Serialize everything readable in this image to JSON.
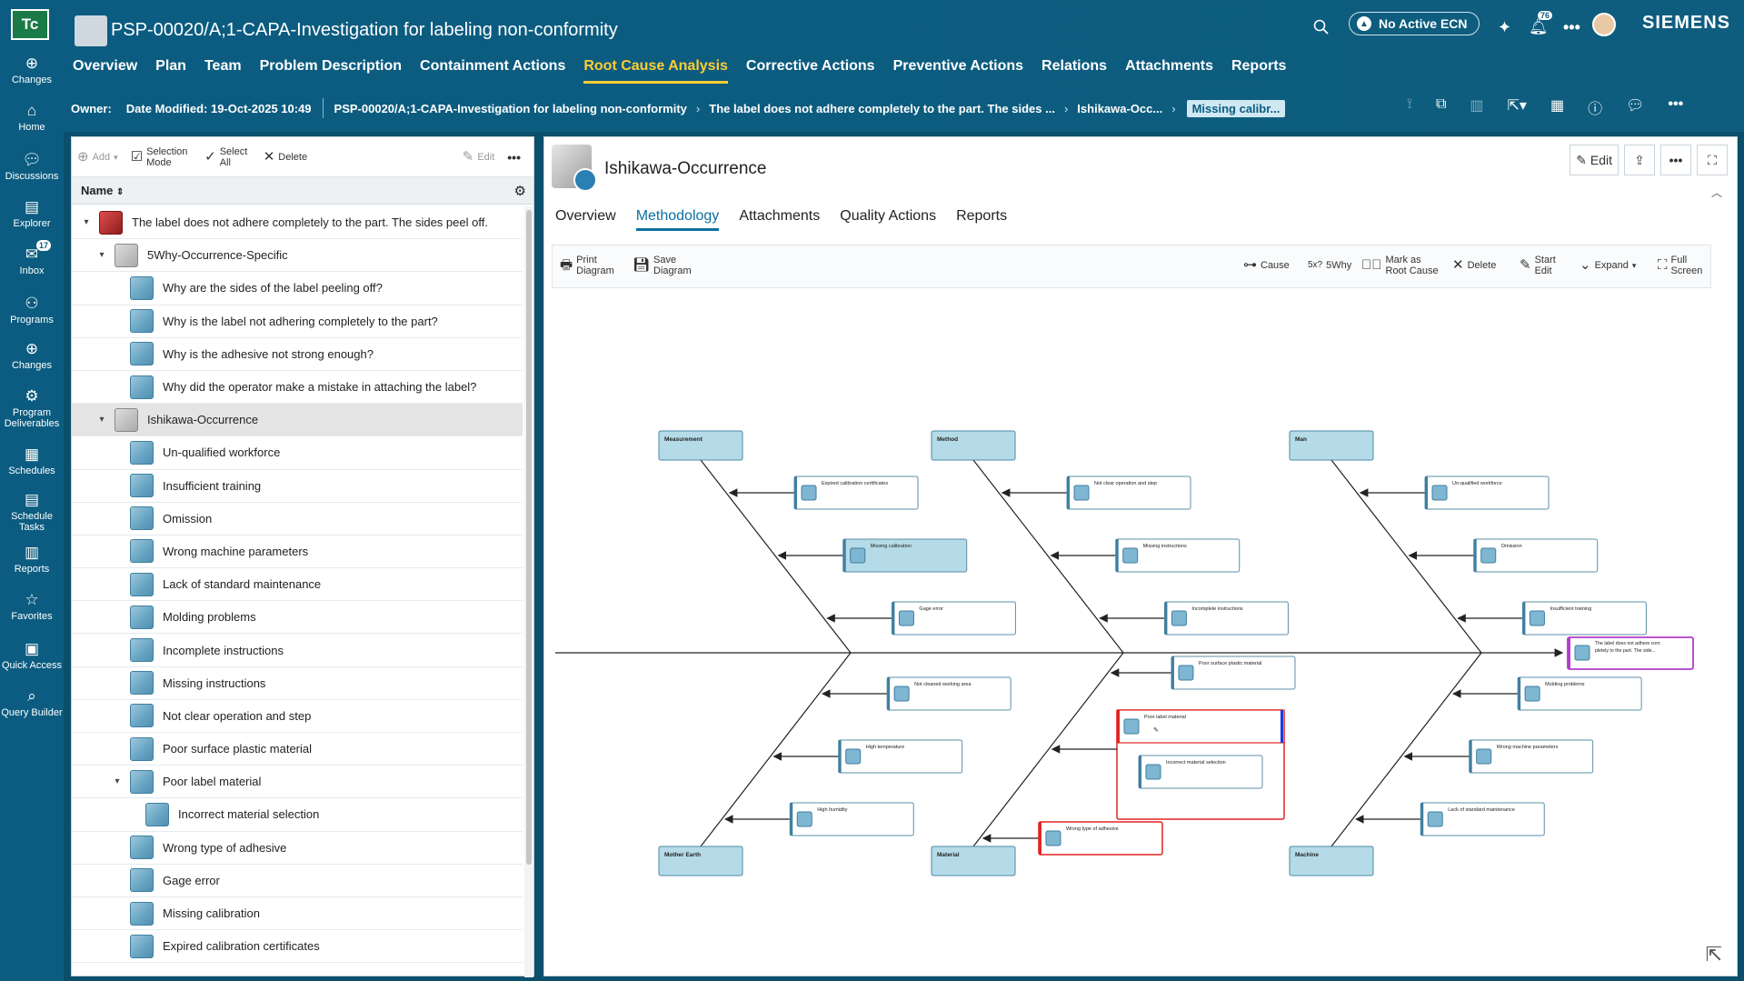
{
  "app": {
    "logo": "Tc",
    "brand": "SIEMENS"
  },
  "rail": [
    {
      "label": "Changes",
      "icon": "changes-icon"
    },
    {
      "label": "Home",
      "icon": "home-icon"
    },
    {
      "label": "Discussions",
      "icon": "discussions-icon"
    },
    {
      "label": "Explorer",
      "icon": "explorer-icon"
    },
    {
      "label": "Inbox",
      "icon": "inbox-icon",
      "badge": "17"
    },
    {
      "label": "Programs",
      "icon": "programs-icon"
    },
    {
      "label": "Changes",
      "icon": "changes-icon"
    },
    {
      "label": "Program Deliverables",
      "icon": "deliverables-icon"
    },
    {
      "label": "Schedules",
      "icon": "schedules-icon"
    },
    {
      "label": "Schedule Tasks",
      "icon": "tasks-icon"
    },
    {
      "label": "Reports",
      "icon": "reports-icon"
    },
    {
      "label": "Favorites",
      "icon": "star-icon"
    },
    {
      "label": "Quick Access",
      "icon": "quick-access-icon"
    },
    {
      "label": "Query Builder",
      "icon": "query-icon"
    }
  ],
  "header": {
    "title": "PSP-00020/A;1-CAPA-Investigation for labeling non-conformity",
    "ecn": "No Active ECN",
    "notifications": "76"
  },
  "tabs": [
    "Overview",
    "Plan",
    "Team",
    "Problem Description",
    "Containment Actions",
    "Root Cause Analysis",
    "Corrective Actions",
    "Preventive Actions",
    "Relations",
    "Attachments",
    "Reports"
  ],
  "active_tab": "Root Cause Analysis",
  "breadcrumb": {
    "owner": "Owner:",
    "date": "Date Modified: 19-Oct-2025 10:49",
    "c1": "PSP-00020/A;1-CAPA-Investigation for labeling non-conformity",
    "c2": "The label does not adhere completely to the part. The sides ...",
    "c3": "Ishikawa-Occ...",
    "chip": "Missing calibr..."
  },
  "left_toolbar": {
    "add": "Add",
    "selection_mode": "Selection Mode",
    "select_all": "Select All",
    "delete": "Delete",
    "edit": "Edit"
  },
  "tree_header": "Name",
  "tree": [
    {
      "label": "The label does not adhere completely to the part. The sides peel off.",
      "level": 0,
      "tw": "▾",
      "kind": "red"
    },
    {
      "label": "5Why-Occurrence-Specific",
      "level": 1,
      "tw": "▾",
      "kind": "grp"
    },
    {
      "label": "Why are the sides of the label peeling off?",
      "level": 2,
      "tw": "",
      "kind": "c"
    },
    {
      "label": "Why is the label not adhering completely to the part?",
      "level": 2,
      "tw": "",
      "kind": "c"
    },
    {
      "label": "Why is the adhesive not strong enough?",
      "level": 2,
      "tw": "",
      "kind": "c"
    },
    {
      "label": "Why did the operator make a mistake in attaching the label?",
      "level": 2,
      "tw": "",
      "kind": "c"
    },
    {
      "label": "Ishikawa-Occurrence",
      "level": 1,
      "tw": "▾",
      "kind": "grp",
      "sel": true
    },
    {
      "label": "Un-qualified workforce",
      "level": 2,
      "tw": "",
      "kind": "c"
    },
    {
      "label": "Insufficient training",
      "level": 2,
      "tw": "",
      "kind": "c"
    },
    {
      "label": "Omission",
      "level": 2,
      "tw": "",
      "kind": "c"
    },
    {
      "label": "Wrong machine parameters",
      "level": 2,
      "tw": "",
      "kind": "c"
    },
    {
      "label": "Lack of standard maintenance",
      "level": 2,
      "tw": "",
      "kind": "c"
    },
    {
      "label": "Molding problems",
      "level": 2,
      "tw": "",
      "kind": "c"
    },
    {
      "label": "Incomplete instructions",
      "level": 2,
      "tw": "",
      "kind": "c"
    },
    {
      "label": "Missing instructions",
      "level": 2,
      "tw": "",
      "kind": "c"
    },
    {
      "label": "Not clear operation and step",
      "level": 2,
      "tw": "",
      "kind": "c"
    },
    {
      "label": "Poor surface plastic material",
      "level": 2,
      "tw": "",
      "kind": "c"
    },
    {
      "label": "Poor label material",
      "level": 2,
      "tw": "▾",
      "kind": "c"
    },
    {
      "label": "Incorrect material selection",
      "level": 3,
      "tw": "",
      "kind": "c"
    },
    {
      "label": "Wrong type of adhesive",
      "level": 2,
      "tw": "",
      "kind": "c"
    },
    {
      "label": "Gage error",
      "level": 2,
      "tw": "",
      "kind": "c"
    },
    {
      "label": "Missing calibration",
      "level": 2,
      "tw": "",
      "kind": "c"
    },
    {
      "label": "Expired calibration certificates",
      "level": 2,
      "tw": "",
      "kind": "c"
    }
  ],
  "panel": {
    "title": "Ishikawa-Occurrence",
    "edit": "Edit",
    "tabs": [
      "Overview",
      "Methodology",
      "Attachments",
      "Quality Actions",
      "Reports"
    ],
    "active_tab": "Methodology"
  },
  "diagram_toolbar": {
    "print": "Print Diagram",
    "save": "Save Diagram",
    "cause": "Cause",
    "fivewhy": "5Why",
    "mark": "Mark as Root Cause",
    "delete": "Delete",
    "start_edit": "Start Edit",
    "expand": "Expand",
    "full": "Full Screen"
  },
  "diagram": {
    "effect": "The label does not adhere completely to the part. The side...",
    "categories": [
      "Measurement",
      "Method",
      "Man",
      "Mother Earth",
      "Material",
      "Machine"
    ],
    "causes": {
      "measurement": [
        "Expired calibration certificates",
        "Missing calibration",
        "Gage error"
      ],
      "method": [
        "Not clear operation and step",
        "Missing instructions",
        "Incomplete instructions"
      ],
      "man": [
        "Un-qualified workforce",
        "Omission",
        "Insufficient training"
      ],
      "mother_earth": [
        "Not cleaned working area",
        "High temperature",
        "High humidity"
      ],
      "material": [
        "Poor surface plastic material",
        "Poor label material",
        "Incorrect material selection",
        "Wrong type of adhesive"
      ],
      "machine": [
        "Molding problems",
        "Wrong machine parameters",
        "Lack of standard maintenance"
      ]
    }
  },
  "colors": {
    "rail": "#0b5c80",
    "accent": "#ffcc33",
    "selected_cause": "#b6dbe8",
    "warn": "#e02424",
    "effect": "#b33cc9"
  }
}
